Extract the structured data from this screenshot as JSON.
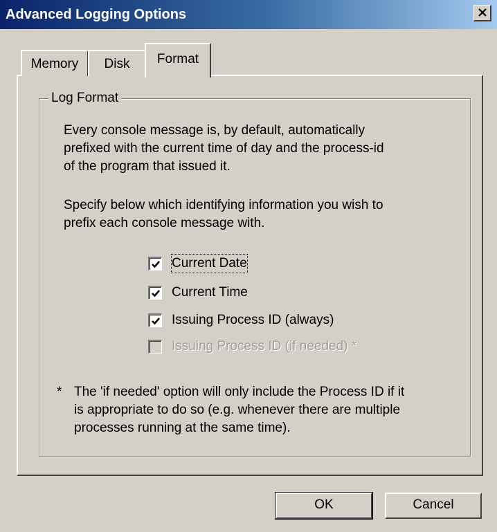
{
  "window": {
    "title": "Advanced Logging Options",
    "close_icon": "close-icon"
  },
  "tabs": [
    {
      "label": "Memory",
      "selected": false
    },
    {
      "label": "Disk",
      "selected": false
    },
    {
      "label": "Format",
      "selected": true
    }
  ],
  "group": {
    "title": "Log Format",
    "description_lines": [
      "Every console message is, by default, automatically",
      "prefixed with the current time of day and the process-id",
      "of the program that issued it."
    ],
    "instruction_lines": [
      "Specify below which identifying information you wish to",
      "prefix each console message with."
    ],
    "options": [
      {
        "label": "Current Date",
        "checked": true,
        "enabled": true,
        "focused": true
      },
      {
        "label": "Current Time",
        "checked": true,
        "enabled": true,
        "focused": false
      },
      {
        "label": "Issuing Process ID (always)",
        "checked": true,
        "enabled": true,
        "focused": false
      },
      {
        "label": "Issuing Process ID (if needed) *",
        "checked": false,
        "enabled": false,
        "focused": false
      }
    ],
    "footnote_marker": "*",
    "footnote_lines": [
      "The 'if needed' option will only include the Process ID if it",
      "is appropriate to do so (e.g. whenever there are multiple",
      "processes running at the same time)."
    ]
  },
  "buttons": {
    "ok_label": "OK",
    "cancel_label": "Cancel"
  },
  "colors": {
    "titlebar_start": "#0a246a",
    "titlebar_end": "#a6caf0",
    "face": "#d4d0c8",
    "disabled_text": "#a0a0a0"
  }
}
